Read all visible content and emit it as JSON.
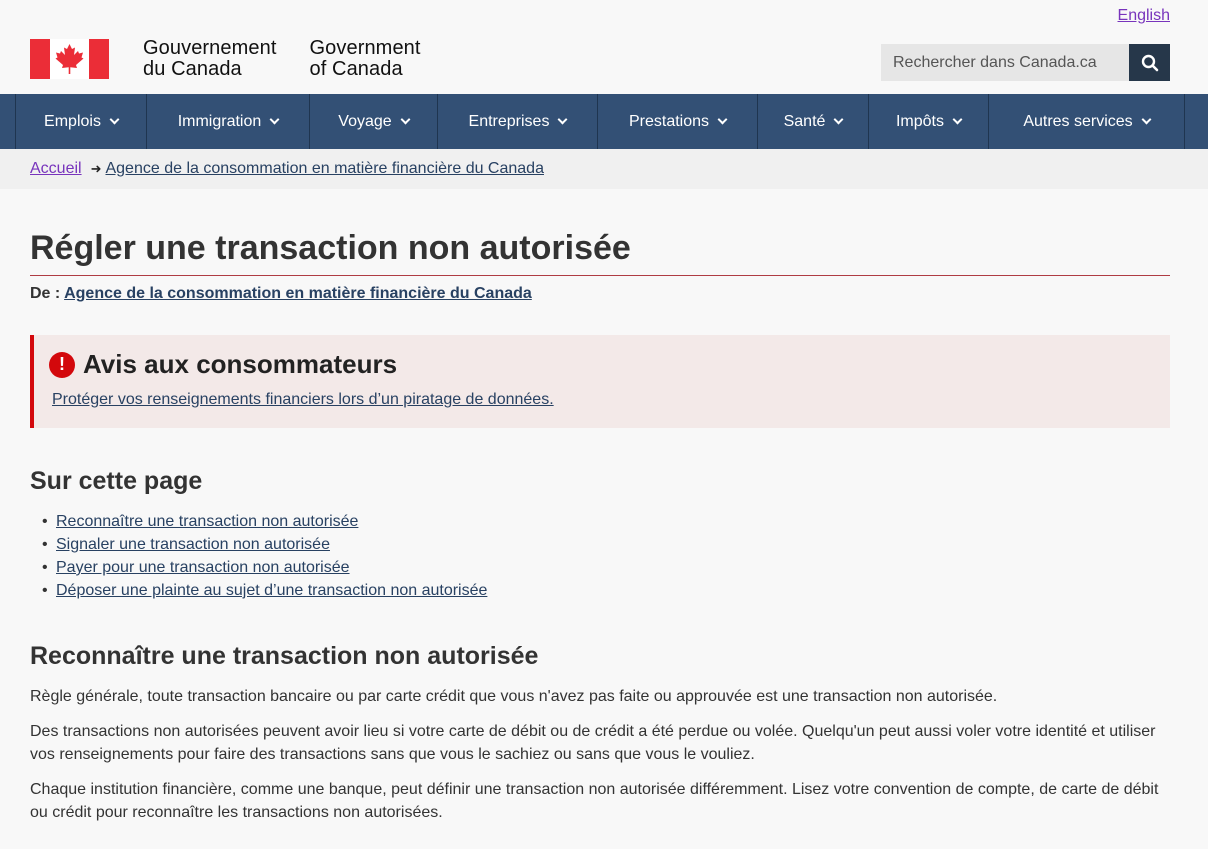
{
  "header": {
    "lang_toggle": "English",
    "sig_fr_line1": "Gouvernement",
    "sig_fr_line2": "du Canada",
    "sig_en_line1": "Government",
    "sig_en_line2": "of Canada",
    "search_placeholder": "Rechercher dans Canada.ca",
    "flag_colors": {
      "red": "#eb2d37",
      "white": "#ffffff"
    }
  },
  "nav": {
    "items": [
      {
        "label": "Emplois"
      },
      {
        "label": "Immigration"
      },
      {
        "label": "Voyage"
      },
      {
        "label": "Entreprises"
      },
      {
        "label": "Prestations"
      },
      {
        "label": "Santé"
      },
      {
        "label": "Impôts"
      },
      {
        "label": "Autres services"
      }
    ],
    "bg_color": "#335075"
  },
  "breadcrumb": {
    "home": "Accueil",
    "current": "Agence de la consommation en matière financière du Canada"
  },
  "page": {
    "title": "Régler une transaction non autorisée",
    "from_label": "De :",
    "from_link": "Agence de la consommation en matière financière du Canada"
  },
  "alert": {
    "icon": "exclamation-icon",
    "title": "Avis aux consommateurs",
    "link": "Protéger vos renseignements financiers lors d’un piratage de données."
  },
  "toc": {
    "title": "Sur cette page",
    "items": [
      "Reconnaître une transaction non autorisée",
      "Signaler une transaction non autorisée",
      "Payer pour une transaction non autorisée",
      "Déposer une plainte au sujet d’une transaction non autorisée"
    ]
  },
  "section": {
    "title": "Reconnaître une transaction non autorisée",
    "paragraphs": [
      "Règle générale, toute transaction bancaire ou par carte crédit que vous n'avez pas faite ou approuvée est une transaction non autorisée.",
      "Des transactions non autorisées peuvent avoir lieu si votre carte de débit ou de crédit a été perdue ou volée. Quelqu'un peut aussi voler votre identité et utiliser vos renseignements pour faire des transactions sans que vous le sachiez ou sans que vous le vouliez.",
      "Chaque institution financière, comme une banque, peut définir une transaction non autorisée différemment. Lisez votre convention de compte, de carte de débit ou crédit pour reconnaître les transactions non autorisées."
    ]
  }
}
